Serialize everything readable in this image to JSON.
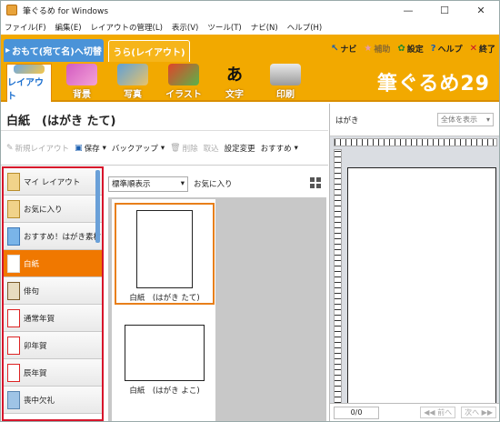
{
  "window": {
    "title": "筆ぐるめ for Windows",
    "minimize": "—",
    "maximize": "☐",
    "close": "✕"
  },
  "menu": [
    "ファイル(F)",
    "編集(E)",
    "レイアウトの管理(L)",
    "表示(V)",
    "ツール(T)",
    "ナビ(N)",
    "ヘルプ(H)"
  ],
  "tabs": {
    "front": "おもて(宛て名)へ切替",
    "back": "うら(レイアウト)"
  },
  "helpers": [
    {
      "label": "ナビ",
      "icon": "arrow-cursor-icon",
      "glyph": "↖"
    },
    {
      "label": "補助",
      "icon": "star-icon",
      "glyph": "★"
    },
    {
      "label": "設定",
      "icon": "gear-icon",
      "glyph": "✿"
    },
    {
      "label": "ヘルプ",
      "icon": "help-icon",
      "glyph": "?"
    },
    {
      "label": "終了",
      "icon": "close-icon",
      "glyph": "✕"
    }
  ],
  "categories": [
    "レイアウト",
    "背景",
    "写真",
    "イラスト",
    "文字",
    "印刷"
  ],
  "brand": "筆ぐるめ29",
  "panel_title": "白紙　(はがき たて)",
  "toolbar": {
    "new_layout": "新規レイアウト",
    "save": "保存",
    "backup": "バックアップ",
    "delete": "削除",
    "import": "取込",
    "change_settings": "設定変更",
    "recommended": "おすすめ"
  },
  "category_list": [
    {
      "label": "マイ レイアウト"
    },
    {
      "label": "お気に入り"
    },
    {
      "label": "おすすめ！はがき素材"
    },
    {
      "label": "白紙"
    },
    {
      "label": "俳句"
    },
    {
      "label": "通常年賀"
    },
    {
      "label": "卯年賀"
    },
    {
      "label": "辰年賀"
    },
    {
      "label": "喪中欠礼"
    }
  ],
  "sort": {
    "selected": "標準順表示",
    "favorites": "お気に入り"
  },
  "templates": [
    {
      "caption": "白紙　(はがき たて)"
    },
    {
      "caption": "白紙　(はがき よこ)"
    }
  ],
  "preview": {
    "label": "はがき",
    "zoom": "全体を表示",
    "page": "0/0",
    "prev": "前へ",
    "next": "次へ"
  },
  "colors": {
    "accent": "#f2a900",
    "selected": "#f07800",
    "highlight_border": "#d7152b",
    "tab_blue": "#4a93d8"
  }
}
